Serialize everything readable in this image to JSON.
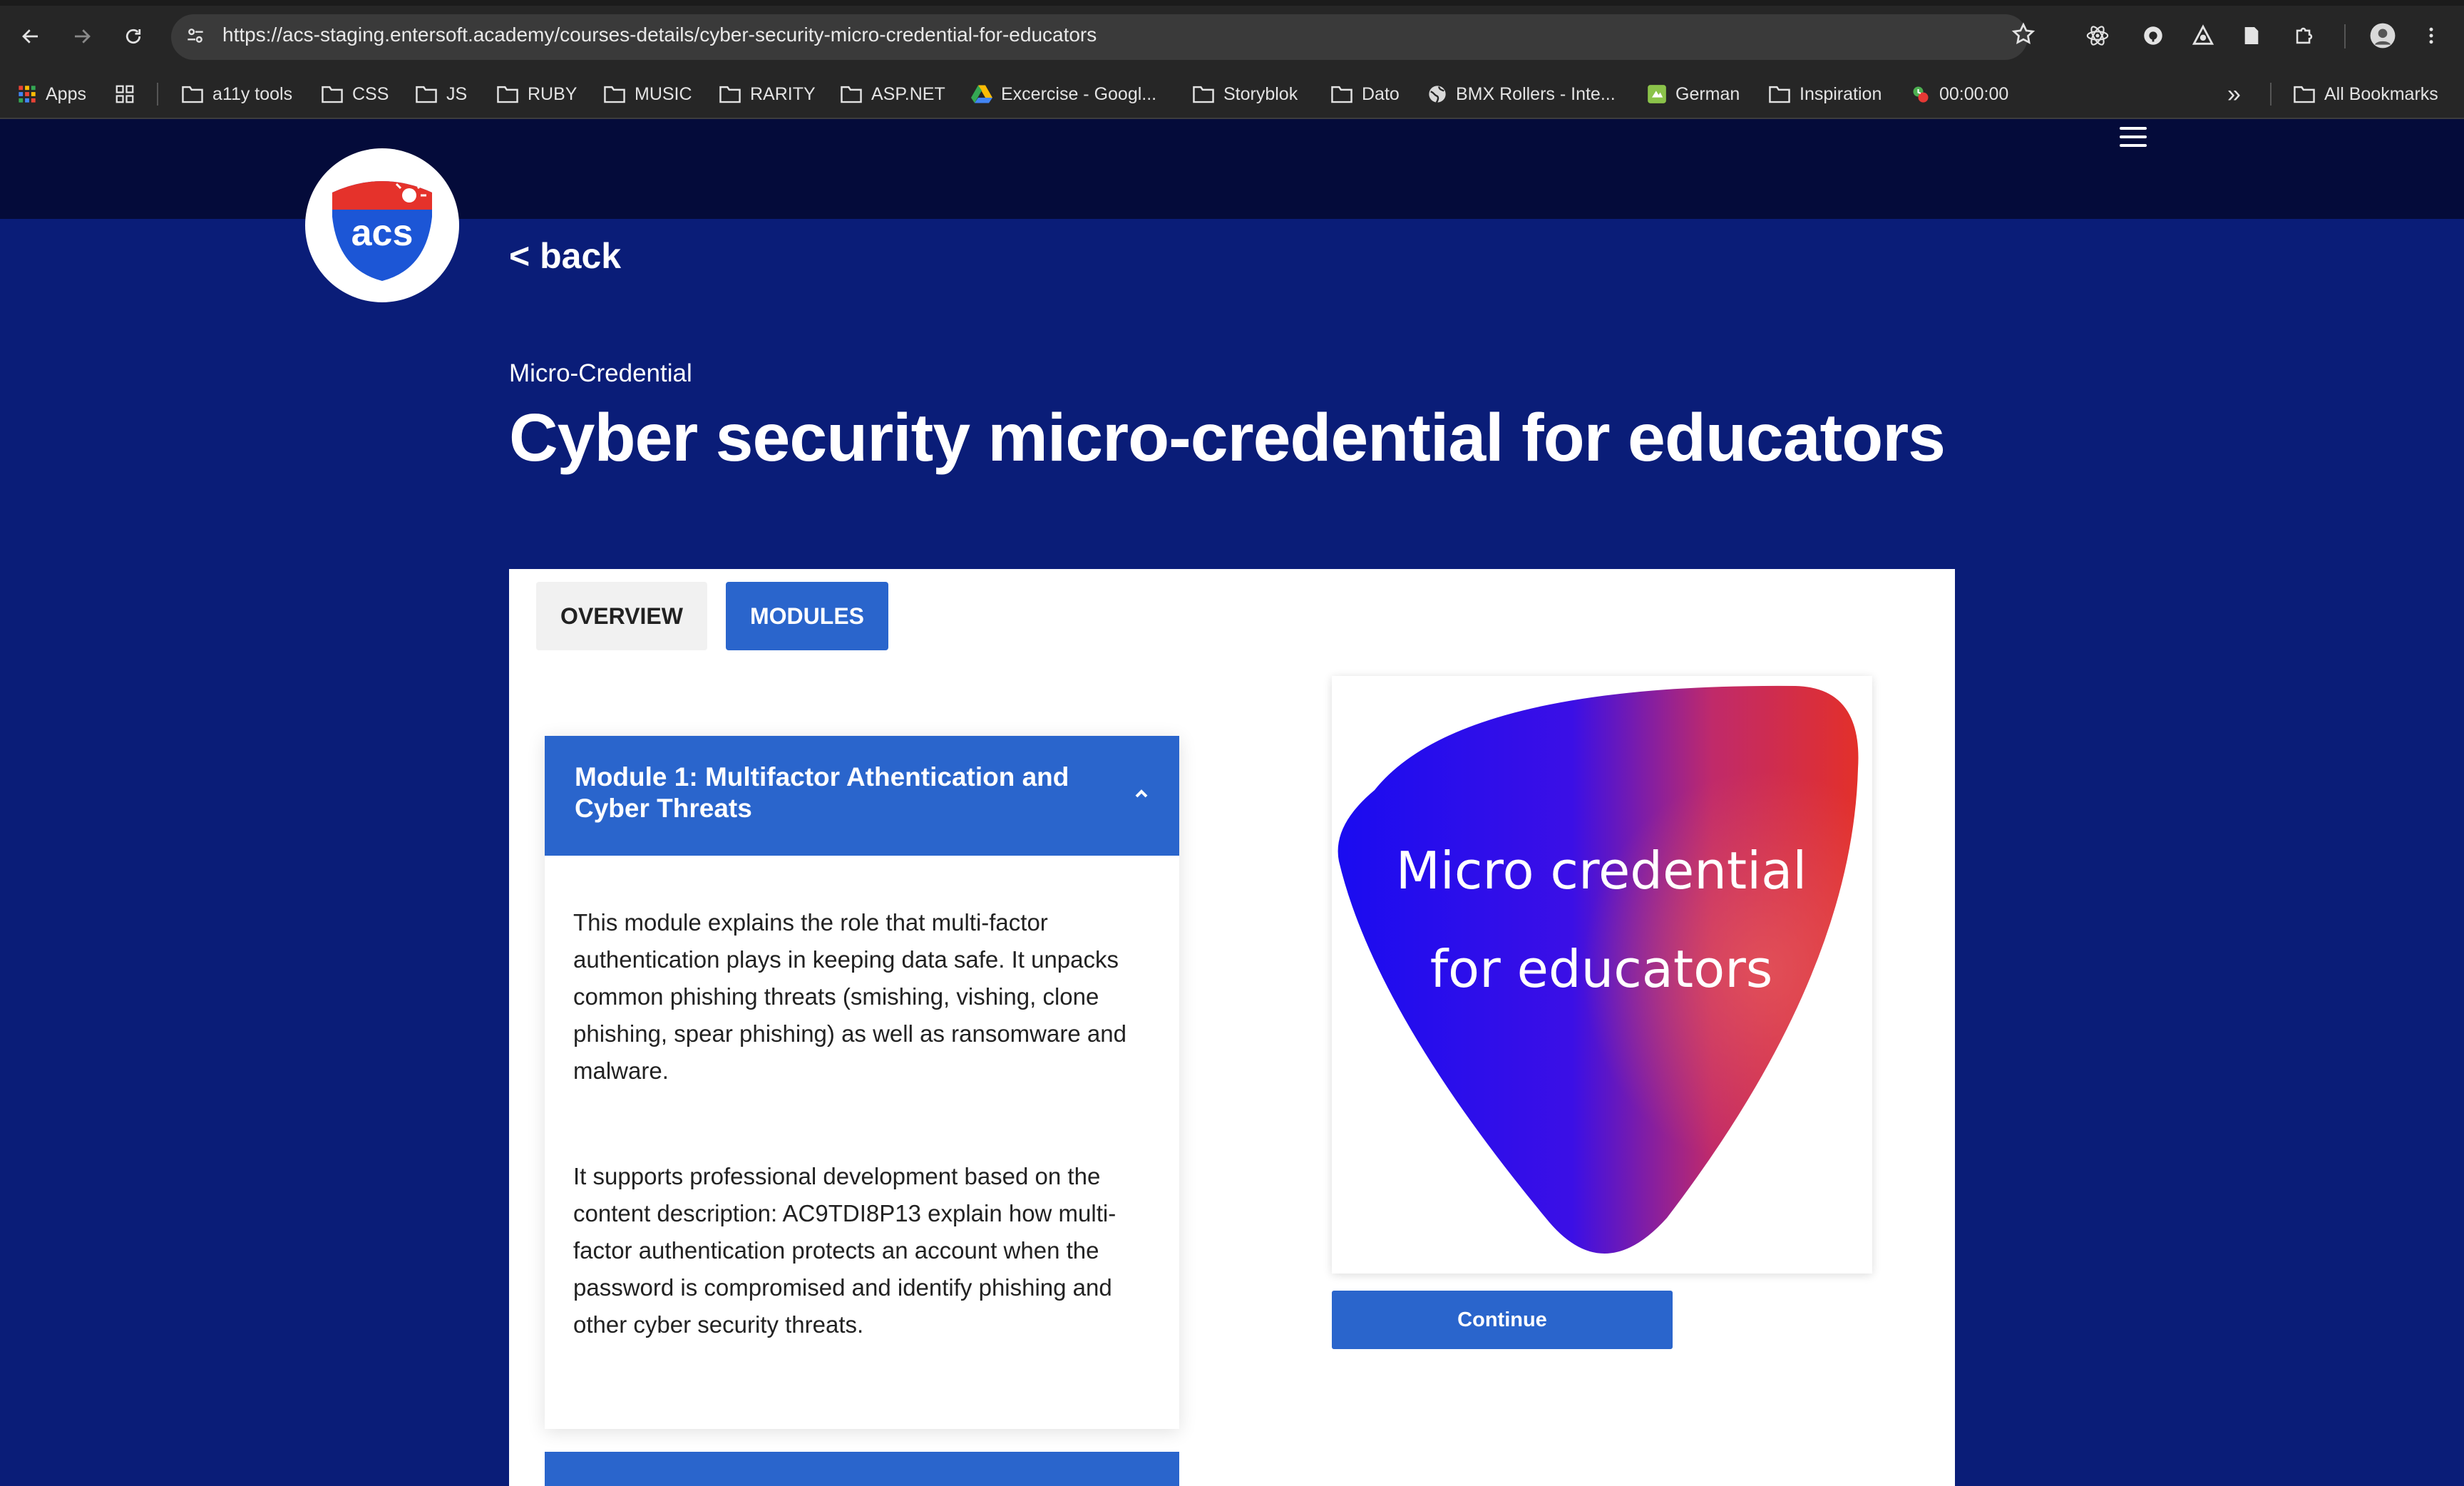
{
  "browser": {
    "url": "https://acs-staging.entersoft.academy/courses-details/cyber-security-micro-credential-for-educators",
    "bookmarks": [
      {
        "label": "Apps",
        "icon": "apps-grid-icon"
      },
      {
        "label": "",
        "icon": "tab-groups-icon"
      },
      {
        "label": "a11y tools",
        "icon": "folder-icon"
      },
      {
        "label": "CSS",
        "icon": "folder-icon"
      },
      {
        "label": "JS",
        "icon": "folder-icon"
      },
      {
        "label": "RUBY",
        "icon": "folder-icon"
      },
      {
        "label": "MUSIC",
        "icon": "folder-icon"
      },
      {
        "label": "RARITY",
        "icon": "folder-icon"
      },
      {
        "label": "ASP.NET",
        "icon": "folder-icon"
      },
      {
        "label": "Excercise - Googl...",
        "icon": "google-drive-icon"
      },
      {
        "label": "Storyblok",
        "icon": "folder-icon"
      },
      {
        "label": "Dato",
        "icon": "folder-icon"
      },
      {
        "label": "BMX Rollers - Inte...",
        "icon": "globe-icon"
      },
      {
        "label": "German",
        "icon": "bookmark-favicon-icon"
      },
      {
        "label": "Inspiration",
        "icon": "folder-icon"
      },
      {
        "label": "00:00:00",
        "icon": "timer-icon"
      }
    ],
    "all_bookmarks_label": "All Bookmarks",
    "overflow_label": "»"
  },
  "page": {
    "logo_text": "acs",
    "back_label": "< back",
    "subtitle": "Micro-Credential",
    "title": "Cyber security micro-credential for educators",
    "tabs": [
      {
        "label": "OVERVIEW",
        "active": false
      },
      {
        "label": "MODULES",
        "active": true
      }
    ],
    "module1": {
      "title": "Module 1: Multifactor Athentication and Cyber Threats",
      "expanded": true,
      "paragraph1": "This module explains the role that multi-factor authentication plays in keeping data safe. It unpacks common phishing threats (smishing, vishing, clone phishing, spear phishing) as well as ransomware and malware.",
      "paragraph2": "It supports professional development based on the content description: AC9TDI8P13 explain how multi-factor authentication protects an account when the password is compromised and identify phishing and other cyber security threats."
    },
    "badge": {
      "line1": "Micro credential",
      "line2": "for educators"
    },
    "continue_label": "Continue"
  },
  "colors": {
    "page_bg": "#0a1d78",
    "top_band": "#040b3a",
    "accent_blue": "#2a65cc",
    "badge_blue": "#1a0cf0",
    "badge_red": "#e3302a"
  }
}
